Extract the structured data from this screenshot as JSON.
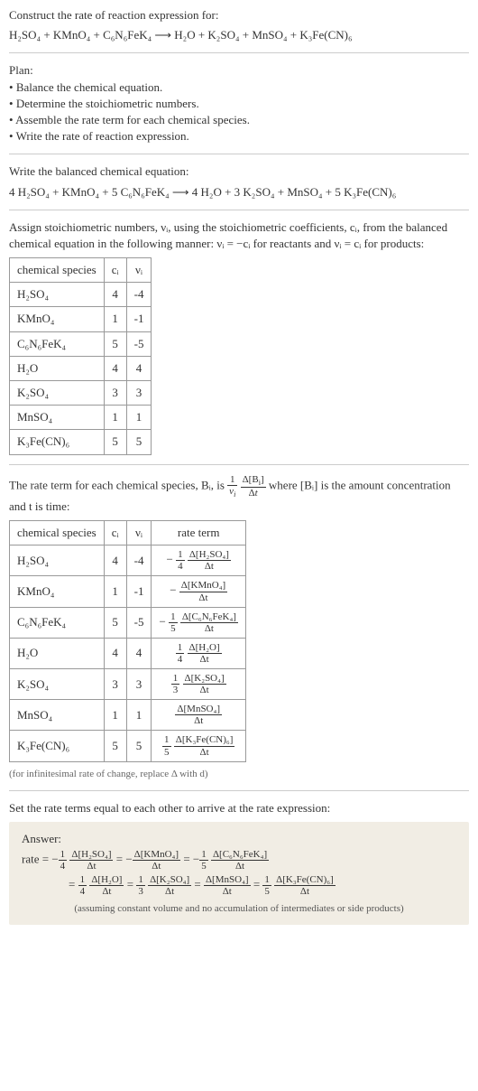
{
  "prompt": {
    "intro": "Construct the rate of reaction expression for:",
    "equation": "H₂SO₄ + KMnO₄ + C₆N₆FeK₄  ⟶  H₂O + K₂SO₄ + MnSO₄ + K₃Fe(CN)₆"
  },
  "plan": {
    "title": "Plan:",
    "items": [
      "Balance the chemical equation.",
      "Determine the stoichiometric numbers.",
      "Assemble the rate term for each chemical species.",
      "Write the rate of reaction expression."
    ]
  },
  "balanced": {
    "title": "Write the balanced chemical equation:",
    "equation": "4 H₂SO₄ + KMnO₄ + 5 C₆N₆FeK₄  ⟶  4 H₂O + 3 K₂SO₄ + MnSO₄ + 5 K₃Fe(CN)₆"
  },
  "assign": {
    "text": "Assign stoichiometric numbers, νᵢ, using the stoichiometric coefficients, cᵢ, from the balanced chemical equation in the following manner: νᵢ = −cᵢ for reactants and νᵢ = cᵢ for products:",
    "headers": [
      "chemical species",
      "cᵢ",
      "νᵢ"
    ],
    "rows": [
      {
        "sp": "H₂SO₄",
        "c": "4",
        "v": "-4"
      },
      {
        "sp": "KMnO₄",
        "c": "1",
        "v": "-1"
      },
      {
        "sp": "C₆N₆FeK₄",
        "c": "5",
        "v": "-5"
      },
      {
        "sp": "H₂O",
        "c": "4",
        "v": "4"
      },
      {
        "sp": "K₂SO₄",
        "c": "3",
        "v": "3"
      },
      {
        "sp": "MnSO₄",
        "c": "1",
        "v": "1"
      },
      {
        "sp": "K₃Fe(CN)₆",
        "c": "5",
        "v": "5"
      }
    ]
  },
  "rateterm": {
    "text_pre": "The rate term for each chemical species, Bᵢ, is ",
    "text_post": " where [Bᵢ] is the amount concentration and t is time:",
    "headers": [
      "chemical species",
      "cᵢ",
      "νᵢ",
      "rate term"
    ],
    "rows": [
      {
        "sp": "H₂SO₄",
        "c": "4",
        "v": "-4",
        "sign": "−",
        "coef_num": "1",
        "coef_den": "4",
        "d": "Δ[H₂SO₄]"
      },
      {
        "sp": "KMnO₄",
        "c": "1",
        "v": "-1",
        "sign": "−",
        "coef_num": "",
        "coef_den": "",
        "d": "Δ[KMnO₄]"
      },
      {
        "sp": "C₆N₆FeK₄",
        "c": "5",
        "v": "-5",
        "sign": "−",
        "coef_num": "1",
        "coef_den": "5",
        "d": "Δ[C₆N₆FeK₄]"
      },
      {
        "sp": "H₂O",
        "c": "4",
        "v": "4",
        "sign": "",
        "coef_num": "1",
        "coef_den": "4",
        "d": "Δ[H₂O]"
      },
      {
        "sp": "K₂SO₄",
        "c": "3",
        "v": "3",
        "sign": "",
        "coef_num": "1",
        "coef_den": "3",
        "d": "Δ[K₂SO₄]"
      },
      {
        "sp": "MnSO₄",
        "c": "1",
        "v": "1",
        "sign": "",
        "coef_num": "",
        "coef_den": "",
        "d": "Δ[MnSO₄]"
      },
      {
        "sp": "K₃Fe(CN)₆",
        "c": "5",
        "v": "5",
        "sign": "",
        "coef_num": "1",
        "coef_den": "5",
        "d": "Δ[K₃Fe(CN)₆]"
      }
    ],
    "note": "(for infinitesimal rate of change, replace Δ with d)"
  },
  "final": {
    "title": "Set the rate terms equal to each other to arrive at the rate expression:",
    "answer_label": "Answer:",
    "line1": [
      {
        "prefix": "rate = −",
        "num": "1",
        "den": "4",
        "dnum": "Δ[H₂SO₄]",
        "dden": "Δt"
      },
      {
        "prefix": " = −",
        "num": "",
        "den": "",
        "dnum": "Δ[KMnO₄]",
        "dden": "Δt"
      },
      {
        "prefix": " = −",
        "num": "1",
        "den": "5",
        "dnum": "Δ[C₆N₆FeK₄]",
        "dden": "Δt"
      }
    ],
    "line2": [
      {
        "prefix": "= ",
        "num": "1",
        "den": "4",
        "dnum": "Δ[H₂O]",
        "dden": "Δt"
      },
      {
        "prefix": " = ",
        "num": "1",
        "den": "3",
        "dnum": "Δ[K₂SO₄]",
        "dden": "Δt"
      },
      {
        "prefix": " = ",
        "num": "",
        "den": "",
        "dnum": "Δ[MnSO₄]",
        "dden": "Δt"
      },
      {
        "prefix": " = ",
        "num": "1",
        "den": "5",
        "dnum": "Δ[K₃Fe(CN)₆]",
        "dden": "Δt"
      }
    ],
    "note": "(assuming constant volume and no accumulation of intermediates or side products)"
  },
  "delta_t": "Δt"
}
